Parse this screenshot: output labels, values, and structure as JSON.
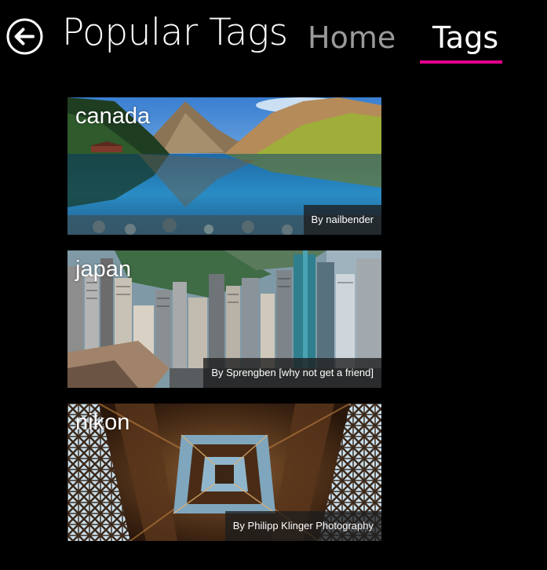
{
  "header": {
    "title": "Popular Tags",
    "nav": [
      {
        "label": "Home",
        "active": false
      },
      {
        "label": "Tags",
        "active": true
      }
    ],
    "accent_color": "#e3008c"
  },
  "tiles": [
    {
      "label": "canada",
      "credit": "By nailbender"
    },
    {
      "label": "japan",
      "credit": "By Sprengben [why not get a friend]"
    },
    {
      "label": "nikon",
      "credit": "By Philipp Klinger Photography"
    }
  ],
  "icons": {
    "back": "back-arrow-icon"
  }
}
